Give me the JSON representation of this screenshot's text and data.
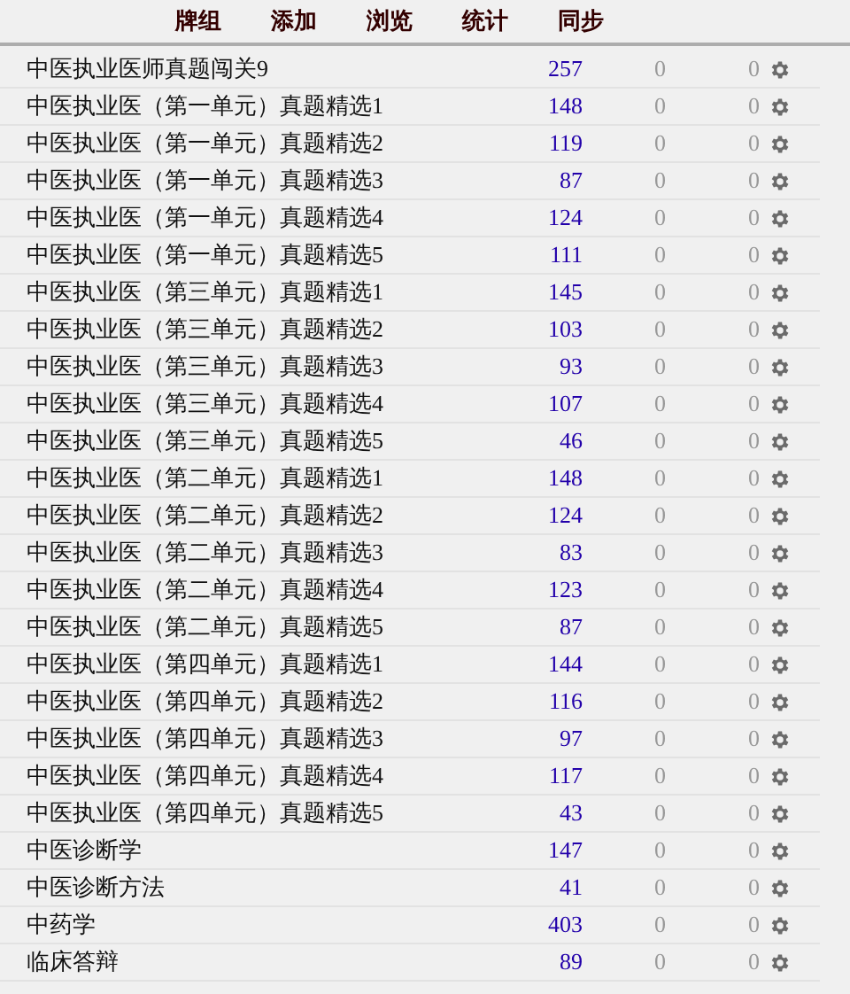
{
  "toolbar": [
    {
      "label": "牌组"
    },
    {
      "label": "添加"
    },
    {
      "label": "浏览"
    },
    {
      "label": "统计"
    },
    {
      "label": "同步"
    }
  ],
  "decks": [
    {
      "name": "中医执业医师真题闯关9",
      "new": "257",
      "learn": "0",
      "due": "0"
    },
    {
      "name": "中医执业医（第一单元）真题精选1",
      "new": "148",
      "learn": "0",
      "due": "0"
    },
    {
      "name": "中医执业医（第一单元）真题精选2",
      "new": "119",
      "learn": "0",
      "due": "0"
    },
    {
      "name": "中医执业医（第一单元）真题精选3",
      "new": "87",
      "learn": "0",
      "due": "0"
    },
    {
      "name": "中医执业医（第一单元）真题精选4",
      "new": "124",
      "learn": "0",
      "due": "0"
    },
    {
      "name": "中医执业医（第一单元）真题精选5",
      "new": "111",
      "learn": "0",
      "due": "0"
    },
    {
      "name": "中医执业医（第三单元）真题精选1",
      "new": "145",
      "learn": "0",
      "due": "0"
    },
    {
      "name": "中医执业医（第三单元）真题精选2",
      "new": "103",
      "learn": "0",
      "due": "0"
    },
    {
      "name": "中医执业医（第三单元）真题精选3",
      "new": "93",
      "learn": "0",
      "due": "0"
    },
    {
      "name": "中医执业医（第三单元）真题精选4",
      "new": "107",
      "learn": "0",
      "due": "0"
    },
    {
      "name": "中医执业医（第三单元）真题精选5",
      "new": "46",
      "learn": "0",
      "due": "0"
    },
    {
      "name": "中医执业医（第二单元）真题精选1",
      "new": "148",
      "learn": "0",
      "due": "0"
    },
    {
      "name": "中医执业医（第二单元）真题精选2",
      "new": "124",
      "learn": "0",
      "due": "0"
    },
    {
      "name": "中医执业医（第二单元）真题精选3",
      "new": "83",
      "learn": "0",
      "due": "0"
    },
    {
      "name": "中医执业医（第二单元）真题精选4",
      "new": "123",
      "learn": "0",
      "due": "0"
    },
    {
      "name": "中医执业医（第二单元）真题精选5",
      "new": "87",
      "learn": "0",
      "due": "0"
    },
    {
      "name": "中医执业医（第四单元）真题精选1",
      "new": "144",
      "learn": "0",
      "due": "0"
    },
    {
      "name": "中医执业医（第四单元）真题精选2",
      "new": "116",
      "learn": "0",
      "due": "0"
    },
    {
      "name": "中医执业医（第四单元）真题精选3",
      "new": "97",
      "learn": "0",
      "due": "0"
    },
    {
      "name": "中医执业医（第四单元）真题精选4",
      "new": "117",
      "learn": "0",
      "due": "0"
    },
    {
      "name": "中医执业医（第四单元）真题精选5",
      "new": "43",
      "learn": "0",
      "due": "0"
    },
    {
      "name": "中医诊断学",
      "new": "147",
      "learn": "0",
      "due": "0"
    },
    {
      "name": "中医诊断方法",
      "new": "41",
      "learn": "0",
      "due": "0"
    },
    {
      "name": "中药学",
      "new": "403",
      "learn": "0",
      "due": "0"
    },
    {
      "name": "临床答辩",
      "new": "89",
      "learn": "0",
      "due": "0"
    }
  ]
}
